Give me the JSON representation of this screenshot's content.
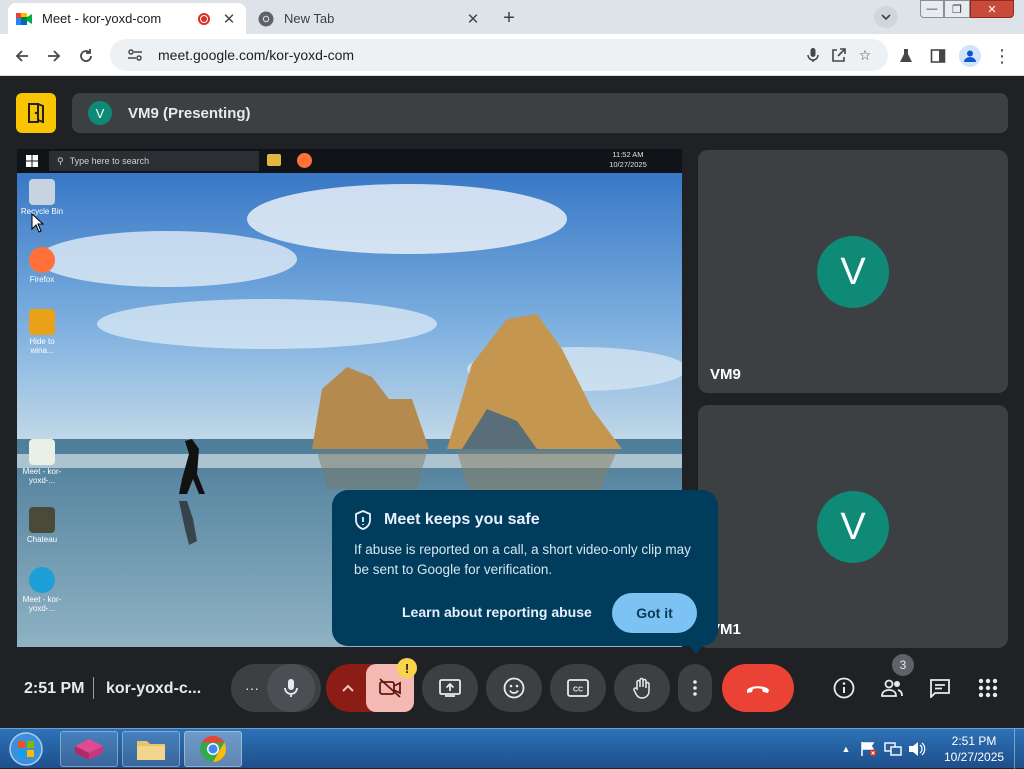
{
  "browser": {
    "tabs": [
      {
        "title": "Meet - kor-yoxd-com",
        "active": true,
        "recording": true
      },
      {
        "title": "New Tab",
        "active": false
      }
    ],
    "address_bar": {
      "url": "meet.google.com/kor-yoxd-com"
    }
  },
  "meet": {
    "presenter_label": "VM9 (Presenting)",
    "presenter_initial": "V",
    "presented_screen": {
      "search_placeholder": "Type here to search",
      "clock_time": "11:52 AM",
      "clock_date": "10/27/2025",
      "desktop_icons": [
        {
          "label": "Recycle Bin"
        },
        {
          "label": "Firefox"
        },
        {
          "label": "Hide to wina..."
        },
        {
          "label": "Meet - kor-yoxd-..."
        },
        {
          "label": "Chateau"
        },
        {
          "label": "Meet - kor-yoxd-..."
        }
      ]
    },
    "participants": [
      {
        "initial": "V",
        "name": "VM9"
      },
      {
        "initial": "V",
        "name": "VM1"
      }
    ],
    "safety_popup": {
      "title": "Meet keeps you safe",
      "body": "If abuse is reported on a call, a short video-only clip may be sent to Google for verification.",
      "link_label": "Learn about reporting abuse",
      "button_label": "Got it"
    },
    "controls": {
      "time": "2:51 PM",
      "meeting_code": "kor-yoxd-c...",
      "more_label": "···",
      "camera_warning": "!",
      "people_count": "3"
    },
    "colors": {
      "leave_button": "#ea4335",
      "camera_off": "#f4b9b3",
      "popup_bg": "#003d5c",
      "avatar": "#0f8a76"
    }
  },
  "windows_taskbar": {
    "clock_time": "2:51 PM",
    "clock_date": "10/27/2025"
  }
}
